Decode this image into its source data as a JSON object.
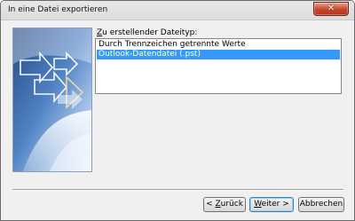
{
  "window": {
    "title": "In eine Datei exportieren",
    "close_glyph": "✕"
  },
  "file_type_list": {
    "label_accesskey": "Z",
    "label_rest": "u erstellender Dateityp:",
    "items": [
      {
        "label": "Durch Trennzeichen getrennte Werte",
        "selected": false
      },
      {
        "label": "Outlook-Datendatei (.pst)",
        "selected": true
      }
    ]
  },
  "buttons": {
    "back": {
      "label": "< Zurück",
      "accesskey": "Z"
    },
    "next_accesskey": "W",
    "next_rest": "eiter >",
    "cancel": "Abbrechen"
  },
  "colors": {
    "selection": "#3399ff",
    "dialog_bg": "#f0f0f0",
    "close_button": "#c8452a"
  }
}
